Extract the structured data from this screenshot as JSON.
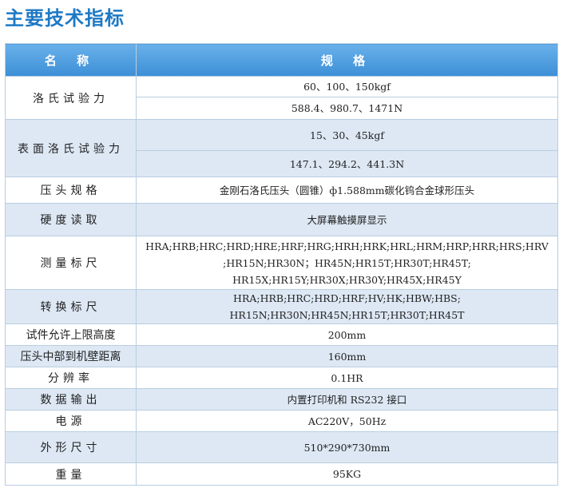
{
  "title": "主要技术指标",
  "header": {
    "name": "名 称",
    "spec": "规 格"
  },
  "rows": [
    {
      "name": "洛氏试验力",
      "values": [
        "60、100、150kgf",
        "588.4、980.7、1471N"
      ]
    },
    {
      "name": "表面洛氏试验力",
      "values": [
        "15、30、45kgf",
        "147.1、294.2、441.3N"
      ]
    },
    {
      "name": "压头规格",
      "values": [
        "金刚石洛氏压头（圆锥）ф1.588mm碳化钨合金球形压头"
      ]
    },
    {
      "name": "硬度读取",
      "values": [
        "大屏幕触摸屏显示"
      ]
    },
    {
      "name": "测量标尺",
      "values": [
        "HRA;HRB;HRC;HRD;HRE;HRF;HRG;HRH;HRK;HRL;HRM;HRP;HRR;HRS;HRV",
        ";HR15N;HR30N；HR45N;HR15T;HR30T;HR45T;",
        "HR15X;HR15Y;HR30X;HR30Y;HR45X;HR45Y"
      ]
    },
    {
      "name": "转换标尺",
      "values": [
        "HRA;HRB;HRC;HRD;HRF;HV;HK;HBW;HBS;",
        "HR15N;HR30N;HR45N;HR15T;HR30T;HR45T"
      ]
    },
    {
      "name": "试件允许上限高度",
      "values": [
        "200mm"
      ]
    },
    {
      "name": "压头中部到机壁距离",
      "values": [
        "160mm"
      ]
    },
    {
      "name": "分辨率",
      "values": [
        "0.1HR"
      ]
    },
    {
      "name": "数据输出",
      "values": [
        "内置打印机和 RS232 接口"
      ]
    },
    {
      "name": "电源",
      "values": [
        "AC220V，50Hz"
      ]
    },
    {
      "name": "外形尺寸",
      "values": [
        "510*290*730mm"
      ]
    },
    {
      "name": "重量",
      "values": [
        "95KG"
      ]
    }
  ]
}
